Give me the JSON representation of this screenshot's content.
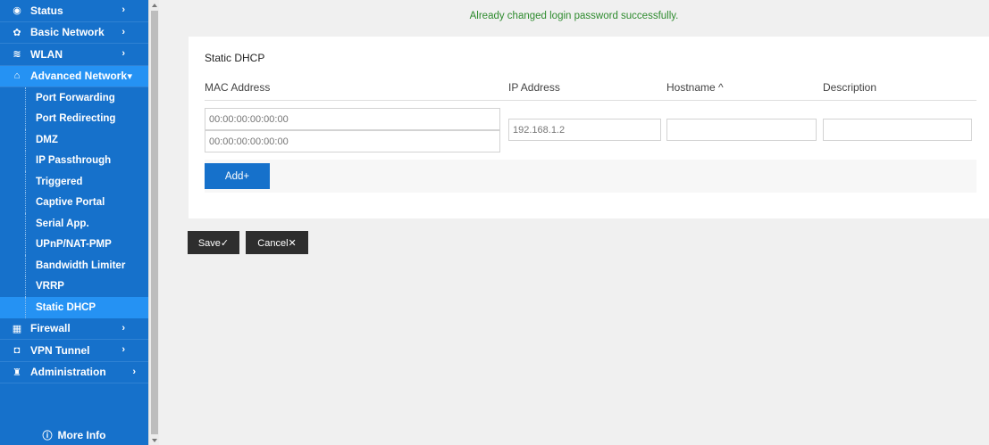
{
  "sidebar": {
    "top_items": [
      {
        "label": "Status",
        "icon": "eye-icon"
      },
      {
        "label": "Basic Network",
        "icon": "network-icon"
      },
      {
        "label": "WLAN",
        "icon": "wifi-icon"
      }
    ],
    "advanced": {
      "label": "Advanced Network",
      "icon": "home-network-icon"
    },
    "sub_items": [
      {
        "label": "Port Forwarding"
      },
      {
        "label": "Port Redirecting"
      },
      {
        "label": "DMZ"
      },
      {
        "label": "IP Passthrough"
      },
      {
        "label": "Triggered"
      },
      {
        "label": "Captive Portal"
      },
      {
        "label": "Serial App."
      },
      {
        "label": "UPnP/NAT-PMP"
      },
      {
        "label": "Bandwidth Limiter"
      },
      {
        "label": "VRRP"
      },
      {
        "label": "Static DHCP"
      }
    ],
    "bottom_items": [
      {
        "label": "Firewall",
        "icon": "firewall-icon"
      },
      {
        "label": "VPN Tunnel",
        "icon": "vpn-icon"
      },
      {
        "label": "Administration",
        "icon": "admin-icon"
      }
    ],
    "more_info": "More Info"
  },
  "notice": "Already changed login password successfully.",
  "card": {
    "title": "Static DHCP",
    "columns": {
      "mac": "MAC Address",
      "ip": "IP Address",
      "hostname": "Hostname ^",
      "description": "Description"
    },
    "row": {
      "mac1_placeholder": "00:00:00:00:00:00",
      "mac2_placeholder": "00:00:00:00:00:00",
      "ip_value": "192.168.1.2",
      "hostname_value": "",
      "description_value": ""
    },
    "add_label": "Add+"
  },
  "actions": {
    "save_label": "Save✓",
    "cancel_label": "Cancel✕"
  },
  "colors": {
    "sidebar_bg": "#1671cb",
    "sidebar_active": "#2592f3",
    "notice_text": "#2e8b2e",
    "button_dark": "#2e2e2e"
  }
}
